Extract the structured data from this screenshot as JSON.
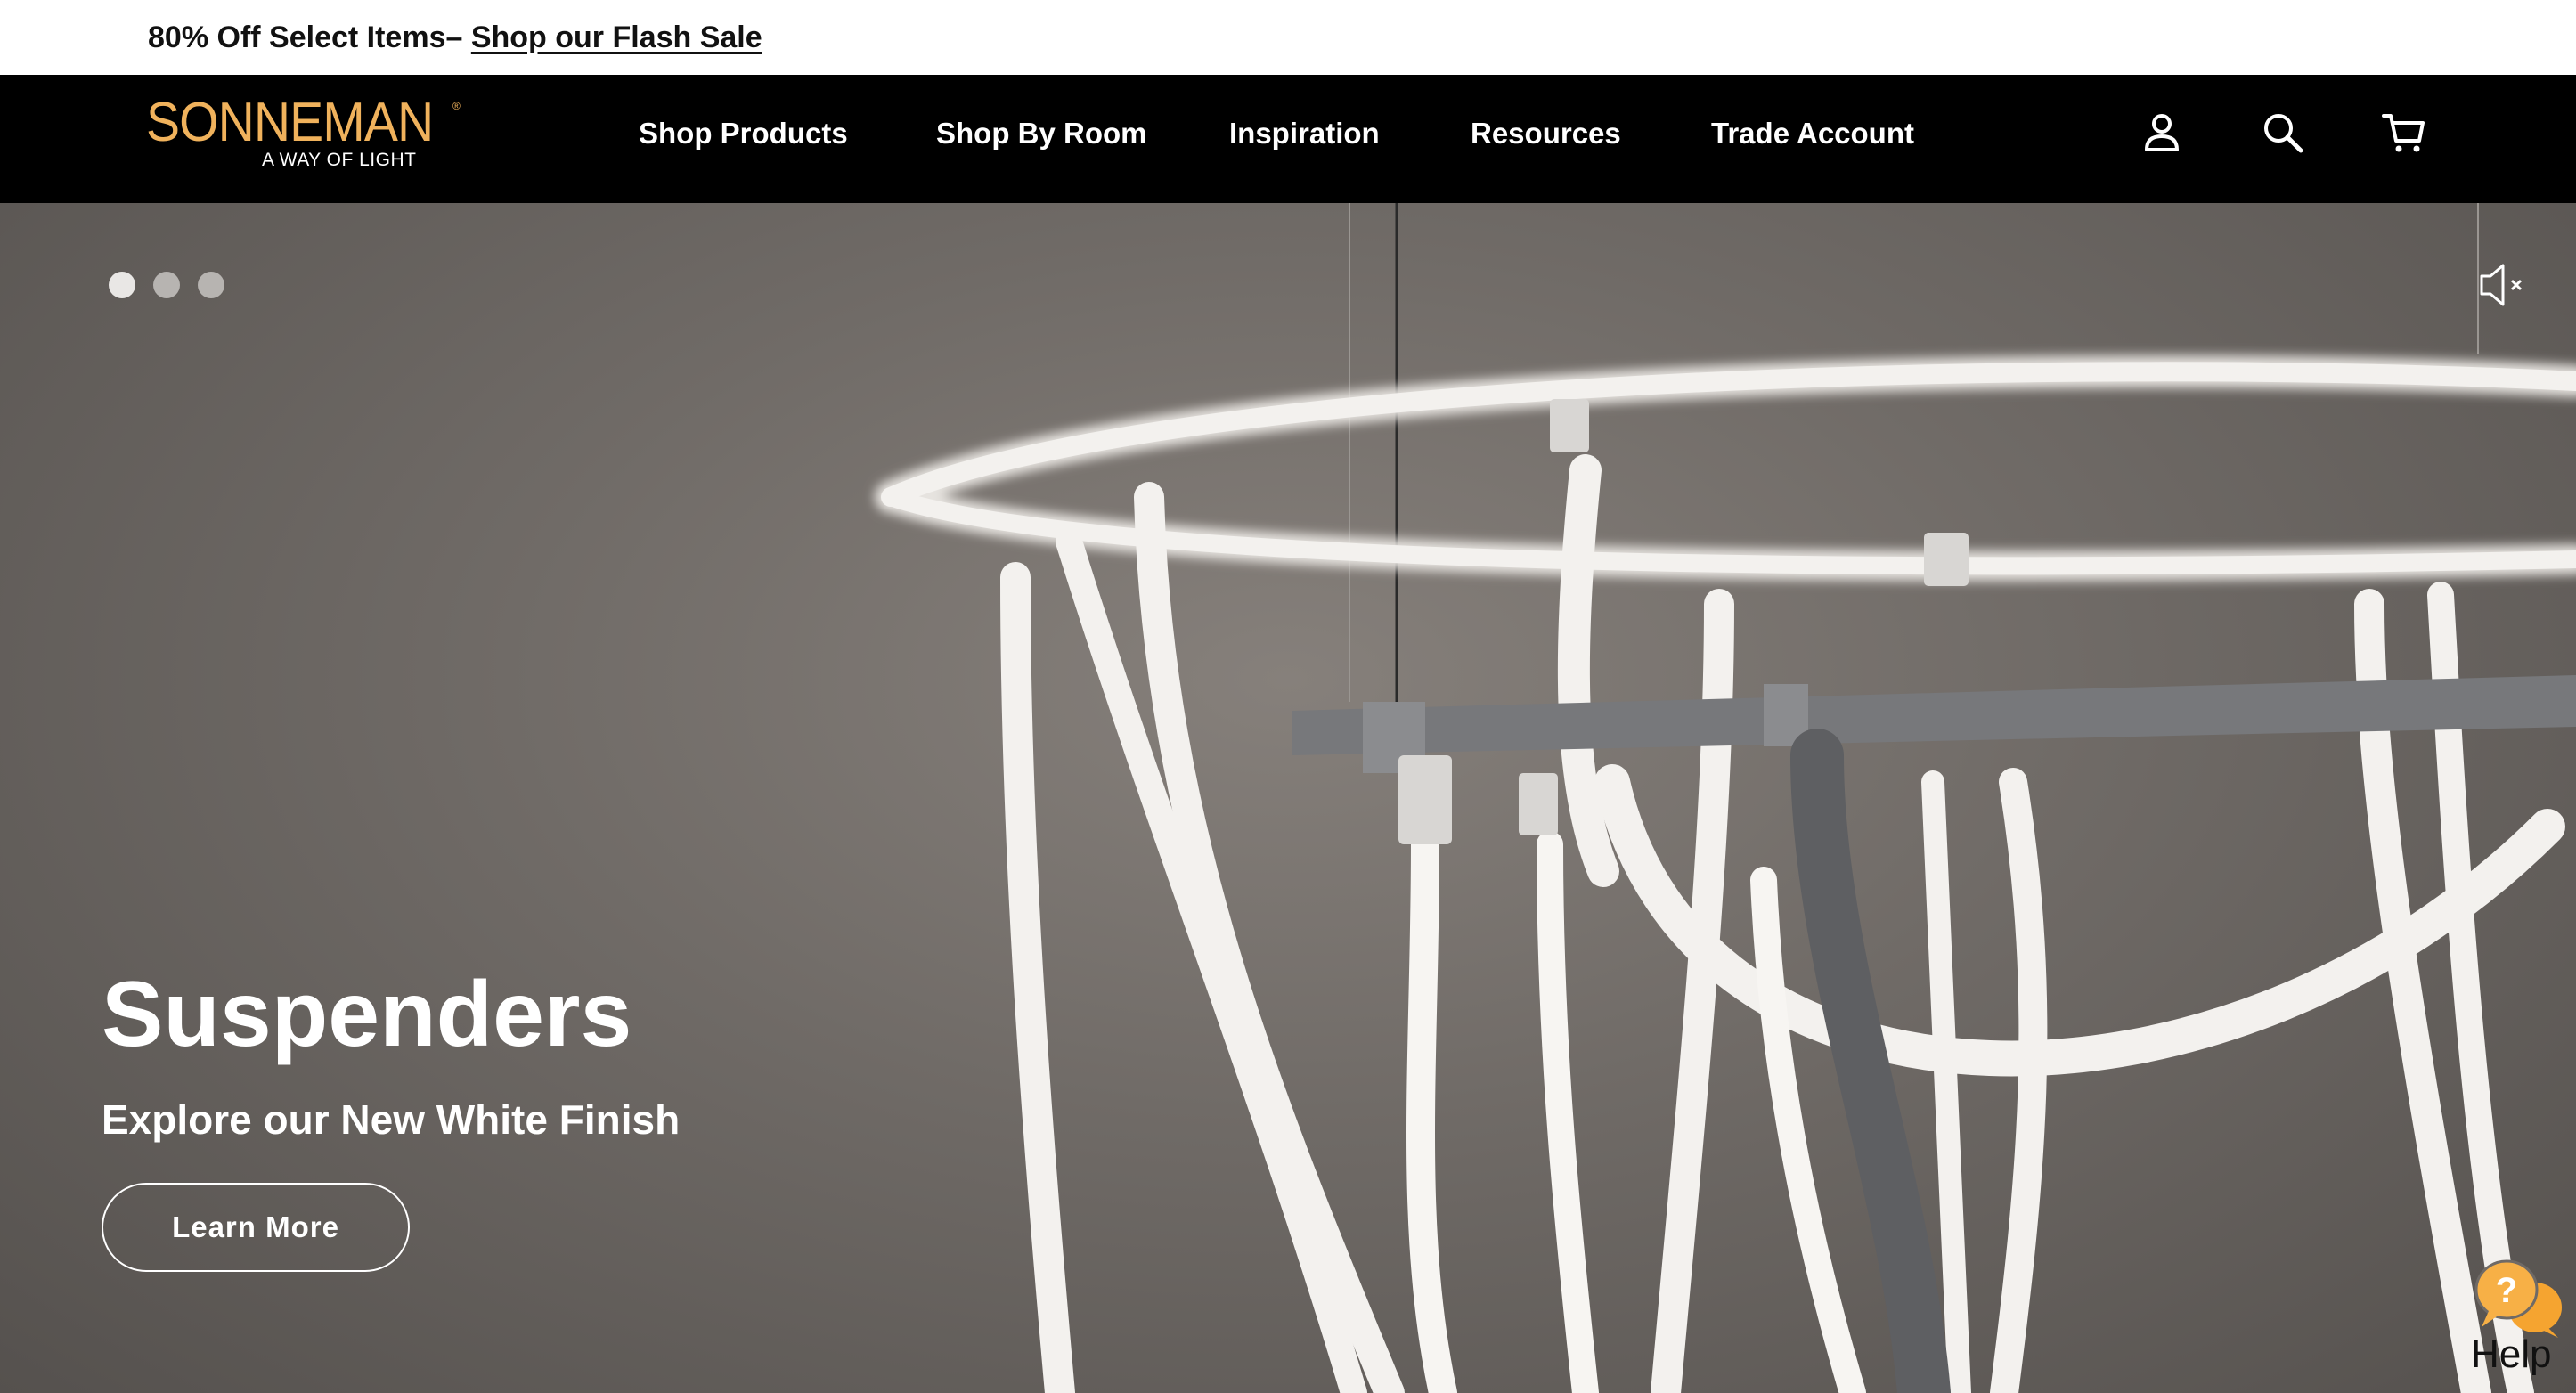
{
  "promo": {
    "text": "80% Off Select Items– ",
    "link": "Shop our Flash Sale"
  },
  "brand": {
    "name": "SONNEMAN",
    "tagline": "A WAY OF LIGHT",
    "color": "#f0b25c"
  },
  "nav": {
    "items": [
      {
        "label": "Shop Products"
      },
      {
        "label": "Shop By Room"
      },
      {
        "label": "Inspiration"
      },
      {
        "label": "Resources"
      },
      {
        "label": "Trade Account"
      }
    ],
    "icons": [
      "account-icon",
      "search-icon",
      "cart-icon"
    ]
  },
  "hero": {
    "title": "Suspenders",
    "subtitle": "Explore our New White Finish",
    "button_label": "Learn More",
    "carousel": {
      "total": 3,
      "active": 1
    },
    "mute_icon": "speaker-muted-icon"
  },
  "help": {
    "label": "Help",
    "icon": "help-chat-icon",
    "accent": "#f5a430"
  }
}
